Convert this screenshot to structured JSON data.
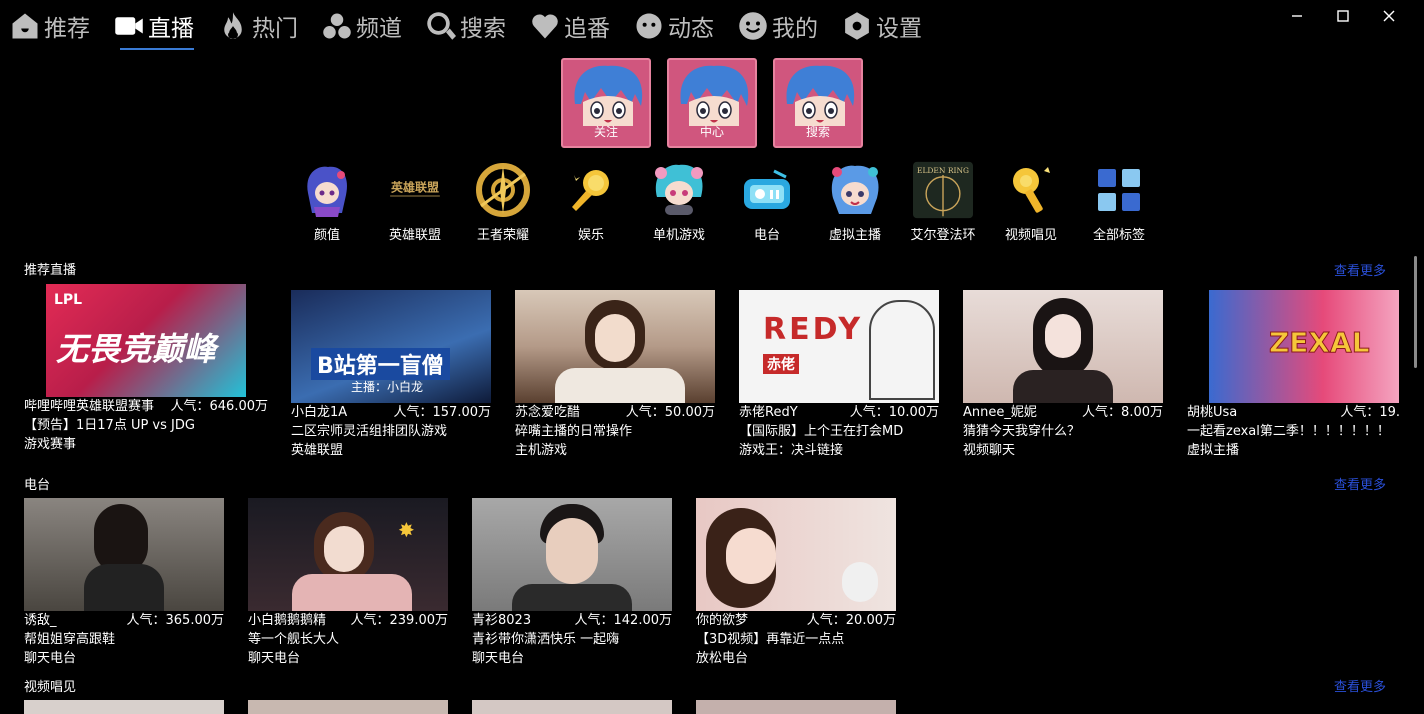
{
  "nav": {
    "items": [
      {
        "label": "推荐",
        "icon": "home-icon"
      },
      {
        "label": "直播",
        "icon": "camera-icon",
        "active": true
      },
      {
        "label": "热门",
        "icon": "flame-icon"
      },
      {
        "label": "频道",
        "icon": "channels-icon"
      },
      {
        "label": "搜索",
        "icon": "search-icon"
      },
      {
        "label": "追番",
        "icon": "heart-icon"
      },
      {
        "label": "动态",
        "icon": "activity-icon"
      },
      {
        "label": "我的",
        "icon": "smiley-icon"
      },
      {
        "label": "设置",
        "icon": "gear-icon"
      }
    ]
  },
  "quick_buttons": [
    {
      "label": "关注"
    },
    {
      "label": "中心"
    },
    {
      "label": "搜索"
    }
  ],
  "categories": [
    {
      "label": "颜值",
      "icon": "beauty-girl-icon"
    },
    {
      "label": "英雄联盟",
      "icon": "league-of-legends-logo",
      "logo_text": "英雄联盟"
    },
    {
      "label": "王者荣耀",
      "icon": "honor-of-kings-logo"
    },
    {
      "label": "娱乐",
      "icon": "microphone-icon"
    },
    {
      "label": "单机游戏",
      "icon": "gamer-girl-icon"
    },
    {
      "label": "电台",
      "icon": "radio-icon"
    },
    {
      "label": "虚拟主播",
      "icon": "vtuber-icon"
    },
    {
      "label": "艾尔登法环",
      "icon": "elden-ring-logo",
      "logo_text": "ELDEN RING"
    },
    {
      "label": "视频唱见",
      "icon": "mic-key-icon"
    },
    {
      "label": "全部标签",
      "icon": "grid-icon"
    }
  ],
  "sections": [
    {
      "title": "推荐直播",
      "more": "查看更多",
      "cards": [
        {
          "host": "哔哩哔哩英雄联盟赛事",
          "pop": "人气：646.00万",
          "title": "【预告】1日17点 UP vs JDG",
          "area": "游戏赛事",
          "thumb_text": "无畏竞巅峰",
          "thumb_sub": "LPL",
          "colors": [
            "#e32b55",
            "#22c2d8"
          ]
        },
        {
          "host": "小白龙1A",
          "pop": "人气：157.00万",
          "title": "二区宗师灵活组排团队游戏",
          "area": "英雄联盟",
          "thumb_text": "B站第一盲僧",
          "thumb_sub": "主播：小白龙",
          "colors": [
            "#1a2c5a",
            "#3b6db1"
          ]
        },
        {
          "host": "苏念爱吃醋",
          "pop": "人气：50.00万",
          "title": "碎嘴主播的日常操作",
          "area": "主机游戏",
          "colors": [
            "#c9b6a4",
            "#6b4c3c"
          ]
        },
        {
          "host": "赤佬RedY",
          "pop": "人气：10.00万",
          "title": "【国际服】上个王在打会MD",
          "area": "游戏王：决斗链接",
          "thumb_text": "REDY",
          "thumb_sub": "赤佬",
          "colors": [
            "#f4f4f4",
            "#c62a2a"
          ]
        },
        {
          "host": "Annee_妮妮",
          "pop": "人气：8.00万",
          "title": "猜猜今天我穿什么？",
          "area": "视频聊天",
          "colors": [
            "#e8d4cc",
            "#3a2a2a"
          ]
        },
        {
          "host": "胡桃Usa",
          "pop": "人气：19.",
          "title": "一起看zexal第二季！！！！！！！",
          "area": "虚拟主播",
          "thumb_text": "ZEXAL",
          "colors": [
            "#3a6ad0",
            "#e64a7a"
          ]
        }
      ]
    },
    {
      "title": "电台",
      "more": "查看更多",
      "cards": [
        {
          "host": "诱敌_",
          "pop": "人气：365.00万",
          "title": "帮姐姐穿高跟鞋",
          "area": "聊天电台",
          "colors": [
            "#8a8580",
            "#2a2a2a"
          ]
        },
        {
          "host": "小白鹅鹅鹅精",
          "pop": "人气：239.00万",
          "title": "等一个舰长大人",
          "area": "聊天电台",
          "colors": [
            "#1a1a22",
            "#d8a8a8"
          ]
        },
        {
          "host": "青衫8023",
          "pop": "人气：142.00万",
          "title": "青衫带你潇洒快乐 一起嗨",
          "area": "聊天电台",
          "colors": [
            "#9a9a9a",
            "#2a2a2a"
          ]
        },
        {
          "host": "你的欲梦",
          "pop": "人气：20.00万",
          "title": "【3D视频】再靠近一点点",
          "area": "放松电台",
          "colors": [
            "#e8c8c4",
            "#e0e0e0"
          ]
        }
      ]
    },
    {
      "title": "视频唱见",
      "more": "查看更多",
      "cards": []
    }
  ],
  "window": {
    "minimize": "minimize-icon",
    "maximize": "maximize-icon",
    "close": "close-icon"
  }
}
